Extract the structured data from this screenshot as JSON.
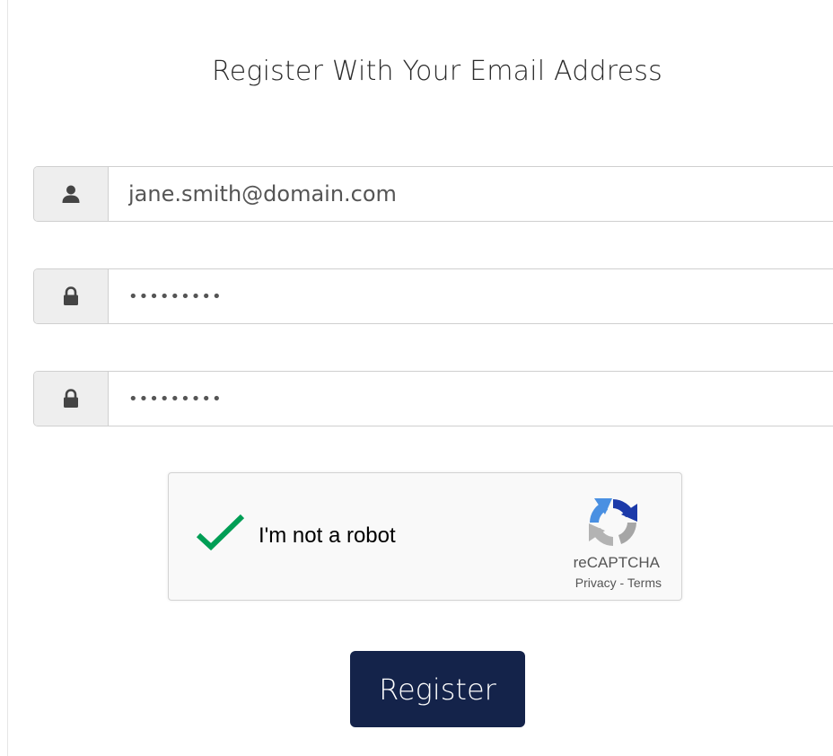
{
  "header": {
    "title": "Register With Your Email Address"
  },
  "form": {
    "email": {
      "icon": "user-icon",
      "value": "jane.smith@domain.com"
    },
    "password": {
      "icon": "lock-icon",
      "value": "•••••••••"
    },
    "confirm_password": {
      "icon": "lock-icon",
      "value": "•••••••••"
    }
  },
  "recaptcha": {
    "label": "I'm not a robot",
    "brand": "reCAPTCHA",
    "privacy": "Privacy",
    "separator": " - ",
    "terms": "Terms",
    "checked": true
  },
  "actions": {
    "register_label": "Register"
  },
  "colors": {
    "button_bg": "#14234a",
    "check_green": "#009e55",
    "addon_bg": "#eeeeee"
  }
}
